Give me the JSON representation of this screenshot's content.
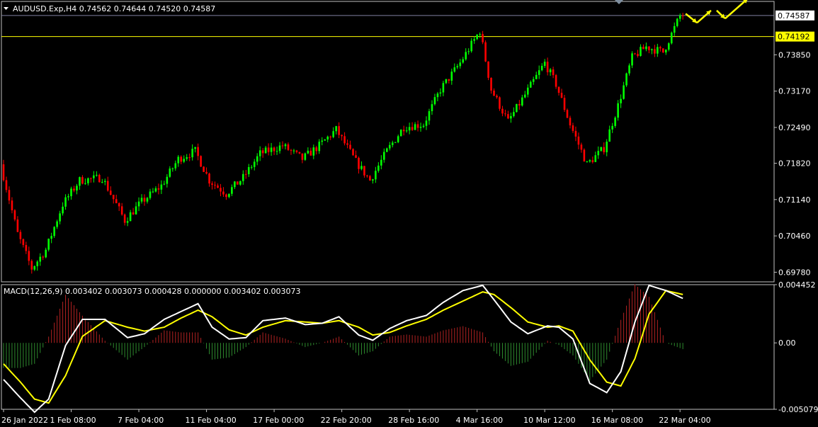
{
  "header": {
    "symbol_line": "AUDUSD.Exp,H4  0.74562 0.74644 0.74520 0.74587",
    "macd_line": "MACD(12,26,9) 0.003402 0.003073 0.000428 0.000000 0.003402 0.003073"
  },
  "colors": {
    "background": "#000000",
    "bull_candle": "#00ff00",
    "bear_candle": "#ff0000",
    "hline": "#ffff00",
    "price_line": "#7f7fa0",
    "macd_main": "#ffffff",
    "macd_signal": "#ffff00",
    "hist_pos": "#b22222",
    "hist_neg": "#2e8b2e",
    "arrow": "#ffff00"
  },
  "chart_data": [
    {
      "type": "candlestick",
      "title": "AUDUSD.Exp,H4",
      "ohlc_current": {
        "open": 0.74562,
        "high": 0.74644,
        "low": 0.7452,
        "close": 0.74587
      },
      "y_ticks": [
        "0.73850",
        "0.73170",
        "0.72490",
        "0.71820",
        "0.71140",
        "0.70460",
        "0.69780"
      ],
      "ylim": [
        0.696,
        0.7485
      ],
      "current_price_label": "0.74587",
      "current_price": 0.74587,
      "hline_label": "0.74192",
      "hline_value": 0.74192,
      "x_labels": [
        "26 Jan 2022",
        "1 Feb 08:00",
        "7 Feb 04:00",
        "11 Feb 04:00",
        "17 Feb 00:00",
        "22 Feb 20:00",
        "28 Feb 16:00",
        "4 Mar 16:00",
        "10 Mar 12:00",
        "16 Mar 08:00",
        "22 Mar 04:00"
      ],
      "x_label_index": [
        0,
        24,
        48,
        72,
        96,
        120,
        144,
        168,
        192,
        216,
        240
      ],
      "path_anchors": [
        [
          0,
          0.718
        ],
        [
          6,
          0.705
        ],
        [
          11,
          0.6985
        ],
        [
          16,
          0.702
        ],
        [
          22,
          0.7105
        ],
        [
          28,
          0.715
        ],
        [
          36,
          0.7155
        ],
        [
          44,
          0.7075
        ],
        [
          50,
          0.711
        ],
        [
          57,
          0.714
        ],
        [
          63,
          0.719
        ],
        [
          69,
          0.7205
        ],
        [
          74,
          0.715
        ],
        [
          80,
          0.7125
        ],
        [
          86,
          0.7155
        ],
        [
          92,
          0.72
        ],
        [
          100,
          0.7215
        ],
        [
          107,
          0.719
        ],
        [
          113,
          0.7215
        ],
        [
          119,
          0.7245
        ],
        [
          126,
          0.7185
        ],
        [
          131,
          0.715
        ],
        [
          137,
          0.7205
        ],
        [
          143,
          0.725
        ],
        [
          150,
          0.7255
        ],
        [
          156,
          0.732
        ],
        [
          163,
          0.737
        ],
        [
          170,
          0.743
        ],
        [
          174,
          0.732
        ],
        [
          180,
          0.726
        ],
        [
          186,
          0.731
        ],
        [
          193,
          0.737
        ],
        [
          197,
          0.733
        ],
        [
          202,
          0.7255
        ],
        [
          208,
          0.718
        ],
        [
          214,
          0.721
        ],
        [
          219,
          0.729
        ],
        [
          224,
          0.738
        ],
        [
          229,
          0.74
        ],
        [
          235,
          0.739
        ],
        [
          241,
          0.7458
        ]
      ],
      "arrows": [
        {
          "from": [
            242,
            0.7462
          ],
          "to": [
            246,
            0.7445
          ]
        },
        {
          "from": [
            246,
            0.7445
          ],
          "to": [
            251,
            0.7468
          ]
        },
        {
          "from": [
            253,
            0.7468
          ],
          "to": [
            256,
            0.7453
          ]
        },
        {
          "from": [
            256,
            0.7453
          ],
          "to": [
            264,
            0.749
          ]
        }
      ]
    },
    {
      "type": "macd",
      "title": "MACD(12,26,9)",
      "values": {
        "main": 0.003402,
        "signal": 0.003073,
        "hist": 0.000428
      },
      "y_ticks": [
        "0.004452",
        "0.00",
        "-0.005079"
      ],
      "ylim": [
        -0.005079,
        0.004452
      ],
      "main_anchors": [
        [
          0,
          -0.0028
        ],
        [
          6,
          -0.0042
        ],
        [
          11,
          -0.0053
        ],
        [
          16,
          -0.0043
        ],
        [
          22,
          -0.0002
        ],
        [
          28,
          0.0018
        ],
        [
          36,
          0.0018
        ],
        [
          44,
          0.0004
        ],
        [
          50,
          0.0007
        ],
        [
          57,
          0.0018
        ],
        [
          63,
          0.0024
        ],
        [
          69,
          0.003
        ],
        [
          74,
          0.0012
        ],
        [
          80,
          0.0003
        ],
        [
          86,
          0.0004
        ],
        [
          92,
          0.0017
        ],
        [
          100,
          0.0019
        ],
        [
          107,
          0.0014
        ],
        [
          113,
          0.0015
        ],
        [
          119,
          0.002
        ],
        [
          126,
          0.0006
        ],
        [
          131,
          0.0002
        ],
        [
          137,
          0.0011
        ],
        [
          143,
          0.0017
        ],
        [
          150,
          0.0021
        ],
        [
          156,
          0.0031
        ],
        [
          163,
          0.004
        ],
        [
          170,
          0.0044
        ],
        [
          174,
          0.0033
        ],
        [
          180,
          0.0016
        ],
        [
          186,
          0.0007
        ],
        [
          193,
          0.0013
        ],
        [
          197,
          0.0012
        ],
        [
          202,
          0.0003
        ],
        [
          208,
          -0.0031
        ],
        [
          214,
          -0.0038
        ],
        [
          219,
          -0.0022
        ],
        [
          224,
          0.0016
        ],
        [
          229,
          0.0044
        ],
        [
          235,
          0.004
        ],
        [
          241,
          0.0034
        ]
      ],
      "signal_anchors": [
        [
          0,
          -0.0016
        ],
        [
          6,
          -0.003
        ],
        [
          11,
          -0.0043
        ],
        [
          16,
          -0.0046
        ],
        [
          22,
          -0.0025
        ],
        [
          28,
          0.0005
        ],
        [
          36,
          0.0017
        ],
        [
          44,
          0.0012
        ],
        [
          50,
          0.0009
        ],
        [
          57,
          0.0012
        ],
        [
          63,
          0.0019
        ],
        [
          69,
          0.0025
        ],
        [
          74,
          0.002
        ],
        [
          80,
          0.001
        ],
        [
          86,
          0.0006
        ],
        [
          92,
          0.0012
        ],
        [
          100,
          0.0017
        ],
        [
          107,
          0.0016
        ],
        [
          113,
          0.0015
        ],
        [
          119,
          0.0017
        ],
        [
          126,
          0.0012
        ],
        [
          131,
          0.0006
        ],
        [
          137,
          0.0008
        ],
        [
          143,
          0.0013
        ],
        [
          150,
          0.0018
        ],
        [
          156,
          0.0025
        ],
        [
          163,
          0.0032
        ],
        [
          170,
          0.0039
        ],
        [
          174,
          0.0037
        ],
        [
          180,
          0.0027
        ],
        [
          186,
          0.0016
        ],
        [
          193,
          0.0012
        ],
        [
          197,
          0.0013
        ],
        [
          202,
          0.0009
        ],
        [
          208,
          -0.0013
        ],
        [
          214,
          -0.003
        ],
        [
          219,
          -0.0033
        ],
        [
          224,
          -0.0012
        ],
        [
          229,
          0.0022
        ],
        [
          235,
          0.004
        ],
        [
          241,
          0.0037
        ]
      ]
    }
  ]
}
